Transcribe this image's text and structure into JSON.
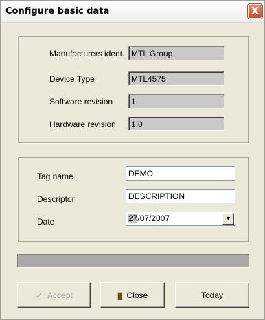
{
  "window": {
    "title": "Configure basic data",
    "close_glyph": "X"
  },
  "device_info": {
    "manufacturer": {
      "label": "Manufacturers ident.",
      "value": "MTL Group"
    },
    "device_type": {
      "label": "Device Type",
      "value": "MTL4575"
    },
    "software_revision": {
      "label": "Software revision",
      "value": "1"
    },
    "hardware_revision": {
      "label": "Hardware revision",
      "value": "1.0"
    }
  },
  "tag_info": {
    "tag_name": {
      "label": "Tag name",
      "value": "DEMO"
    },
    "descriptor": {
      "label": "Descriptor",
      "value": "DESCRIPTION"
    },
    "date": {
      "label": "Date",
      "value_selected": "27",
      "value_rest": "/07/2007"
    }
  },
  "progress": {
    "value": 0
  },
  "buttons": {
    "accept": {
      "mnemonic": "A",
      "rest": "ccept",
      "icon": "check-icon"
    },
    "close": {
      "mnemonic": "C",
      "rest": "lose",
      "icon": "door-icon"
    },
    "today": {
      "mnemonic": "T",
      "rest": "oday"
    }
  },
  "colors": {
    "window_bg": "#ece9d8",
    "readonly_bg": "#c9c9c9",
    "close_button": "#c7502f"
  }
}
